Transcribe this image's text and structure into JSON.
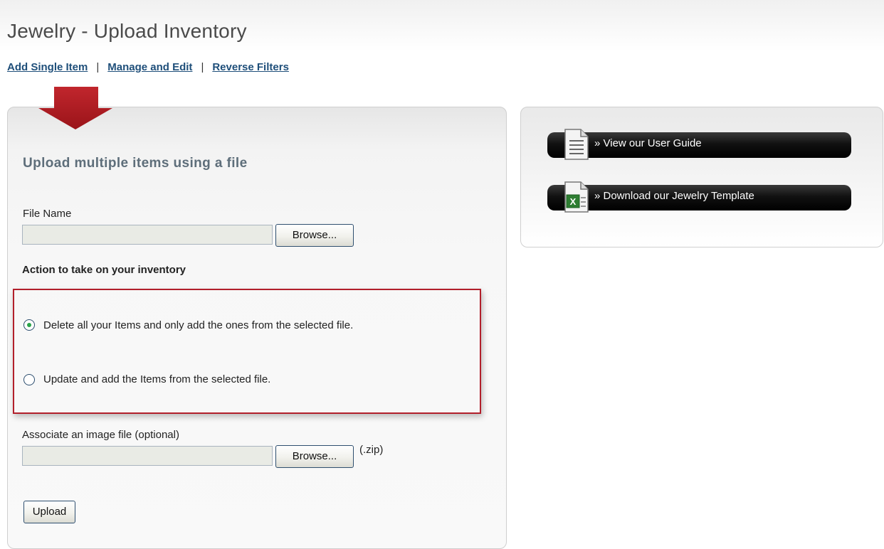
{
  "page": {
    "title": "Jewelry - Upload Inventory"
  },
  "subnav": {
    "links": [
      "Add Single Item",
      "Manage and Edit",
      "Reverse Filters"
    ],
    "separator": "|"
  },
  "upload_panel": {
    "heading": "Upload multiple items using a file",
    "file_name_label": "File Name",
    "file_name_value": "",
    "browse_label": "Browse...",
    "action_label": "Action to take on your inventory",
    "options": [
      {
        "label": "Delete all your Items and only add the ones from the selected file.",
        "selected": true
      },
      {
        "label": "Update and add the Items from the selected file.",
        "selected": false
      }
    ],
    "image_label": "Associate an image file (optional)",
    "image_value": "",
    "image_browse_label": "Browse...",
    "zip_hint": "(.zip)",
    "upload_label": "Upload"
  },
  "resources": {
    "user_guide": "» View our User Guide",
    "template": "» Download our Jewelry Template"
  },
  "colors": {
    "highlight_border": "#b21f2b",
    "arrow": "#b31c22",
    "link": "#1f4f7a",
    "radio_selected": "#2aa34a"
  },
  "icons": {
    "arrow": "down-arrow-icon",
    "user_guide": "document-icon",
    "template": "excel-file-icon"
  }
}
